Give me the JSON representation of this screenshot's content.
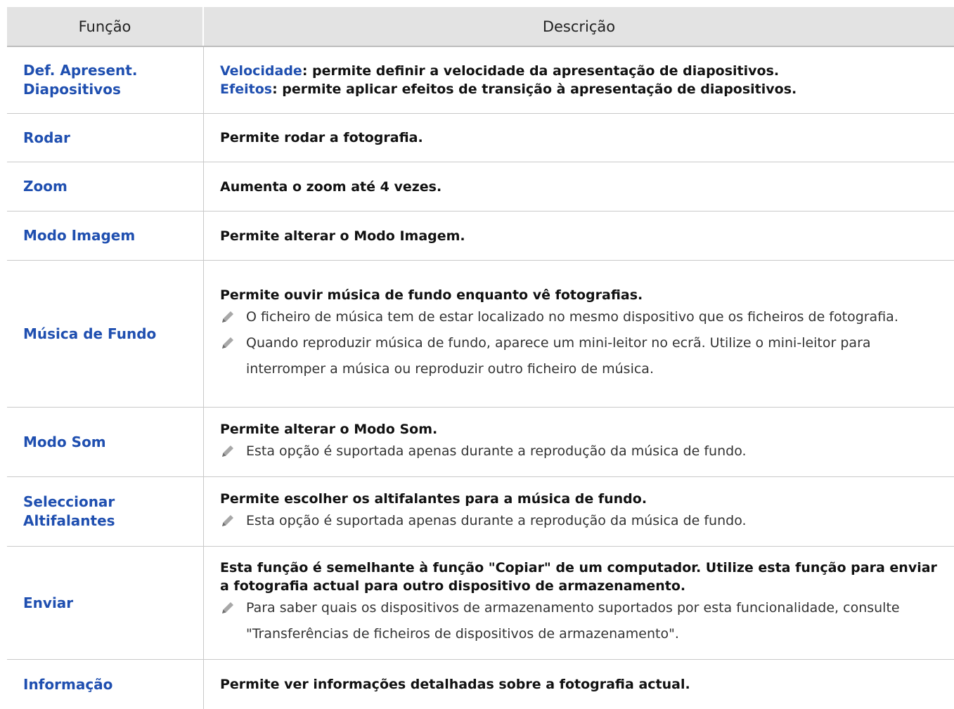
{
  "header": {
    "col1": "Função",
    "col2": "Descrição"
  },
  "rows": [
    {
      "function": "Def. Apresent. Diapositivos",
      "desc": [
        {
          "key": "Velocidade",
          "text": ": permite definir a velocidade da apresentação de diapositivos."
        },
        {
          "key": "Efeitos",
          "text": ": permite aplicar efeitos de transição à apresentação de diapositivos."
        }
      ]
    },
    {
      "function": "Rodar",
      "text": "Permite rodar a fotografia."
    },
    {
      "function": "Zoom",
      "text": "Aumenta o zoom até 4 vezes."
    },
    {
      "function": "Modo Imagem",
      "text": "Permite alterar o Modo Imagem."
    },
    {
      "function": "Música de Fundo",
      "text": "Permite ouvir música de fundo enquanto vê fotografias.",
      "notes": [
        "O ficheiro de música tem de estar localizado no mesmo dispositivo que os ficheiros de fotografia.",
        "Quando reproduzir música de fundo, aparece um mini-leitor no ecrã. Utilize o mini-leitor para interromper a música ou reproduzir outro ficheiro de música."
      ]
    },
    {
      "function": "Modo Som",
      "text": "Permite alterar o Modo Som.",
      "notes": [
        "Esta opção é suportada apenas durante a reprodução da música de fundo."
      ]
    },
    {
      "function": "Seleccionar Altifalantes",
      "text": "Permite escolher os altifalantes para a música de fundo.",
      "notes": [
        "Esta opção é suportada apenas durante a reprodução da música de fundo."
      ]
    },
    {
      "function": "Enviar",
      "text": "Esta função é semelhante à função \"Copiar\" de um computador. Utilize esta função para enviar a fotografia actual para outro dispositivo de armazenamento.",
      "notes": [
        "Para saber quais os dispositivos de armazenamento suportados por esta funcionalidade, consulte \"Transferências de ficheiros de dispositivos de armazenamento\"."
      ]
    },
    {
      "function": "Informação",
      "text": "Permite ver informações detalhadas sobre a fotografia actual."
    }
  ],
  "icons": {
    "note": "pencil-icon"
  },
  "colors": {
    "accent": "#1f4fb0",
    "header_bg": "#e3e3e3",
    "border": "#c9c9c9"
  }
}
